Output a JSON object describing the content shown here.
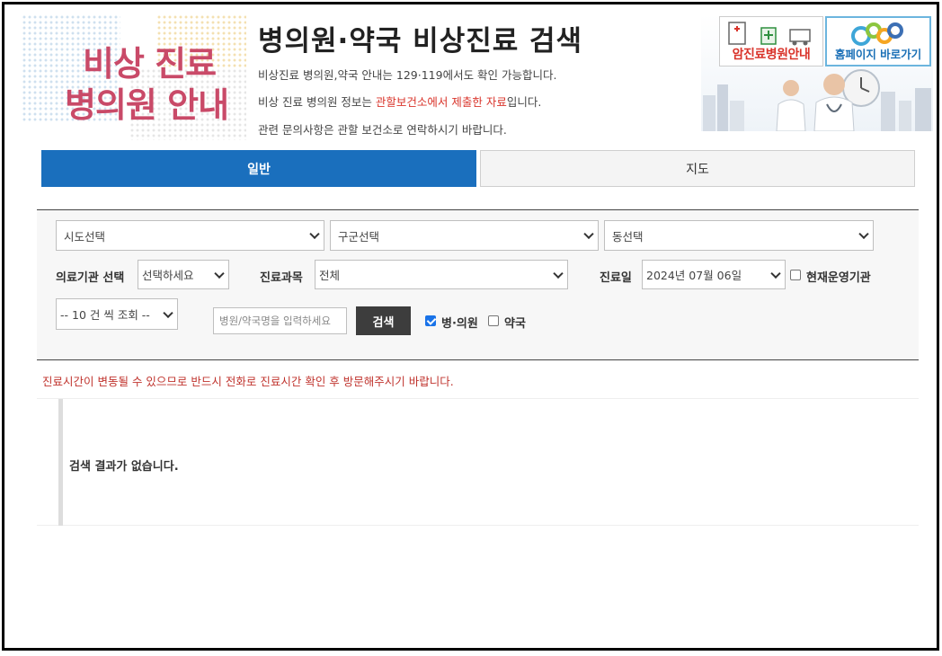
{
  "banner_left": {
    "line1": "비상 진료",
    "line2": "병의원 안내"
  },
  "header": {
    "title": "병의원·약국 비상진료 검색",
    "sub1": "비상진료 병의원,약국 안내는 129·119에서도 확인 가능합니다.",
    "sub2_pre": "비상 진료 병의원 정보는 ",
    "sub2_red": "관할보건소에서 제출한 자료",
    "sub2_post": "입니다.",
    "sub3": "관련 문의사항은 관할 보건소로 연락하시기 바랍니다."
  },
  "banner_right": {
    "cancer_label": "암진료병원안내",
    "home_label": "홈페이지 바로가기"
  },
  "tabs": {
    "general": "일반",
    "map": "지도"
  },
  "search": {
    "sido": "시도선택",
    "gugun": "구군선택",
    "dong": "동선택",
    "inst_label": "의료기관 선택",
    "inst_value": "선택하세요",
    "dept_label": "진료과목",
    "dept_value": "전체",
    "date_label": "진료일",
    "date_value": "2024년 07월 06일",
    "open_now_label": "현재운영기관",
    "page_size": "-- 10 건 씩 조회 --",
    "name_placeholder": "병원/약국명을 입력하세요",
    "search_button": "검색",
    "hospital_label": "병·의원",
    "pharmacy_label": "약국",
    "hospital_checked": true,
    "pharmacy_checked": false,
    "open_now_checked": false
  },
  "notice": "진료시간이 변동될 수 있으므로 반드시 전화로 진료시간 확인 후 방문해주시기 바랍니다.",
  "result": {
    "empty_message": "검색 결과가 없습니다."
  },
  "colors": {
    "primary": "#1a6fbd",
    "brand_pink": "#c94a68",
    "alert_red": "#c0342e"
  }
}
